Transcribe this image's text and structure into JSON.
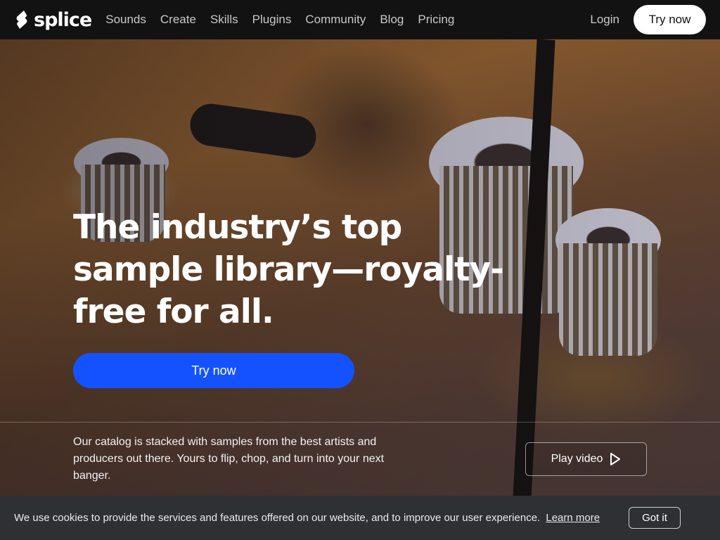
{
  "brand": {
    "name": "splice"
  },
  "nav": {
    "links": [
      "Sounds",
      "Create",
      "Skills",
      "Plugins",
      "Community",
      "Blog",
      "Pricing"
    ],
    "login": "Login",
    "cta": "Try now"
  },
  "hero": {
    "headline": "The industry’s top sample library—royalty-free for all.",
    "cta": "Try now",
    "description": "Our catalog is stacked with samples from the best artists and producers out there. Yours to flip, chop, and turn into your next banger.",
    "play_video": "Play video"
  },
  "cookie": {
    "text": "We use cookies to provide the services and features offered on our website, and to improve our user experience.",
    "learn_more": "Learn more",
    "dismiss": "Got it"
  },
  "colors": {
    "accent": "#1452ff",
    "nav_bg": "#121212",
    "cookie_bg": "#2f3033"
  }
}
